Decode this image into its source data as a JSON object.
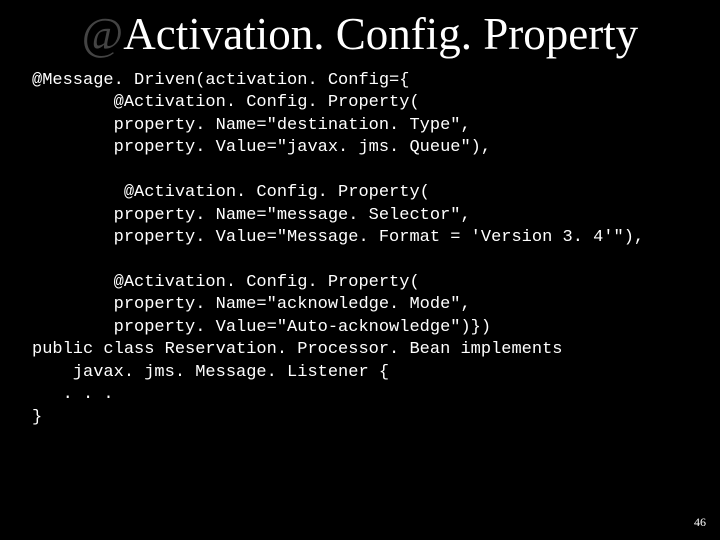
{
  "slide": {
    "title_at": "@",
    "title_rest": "Activation. Config. Property",
    "code_lines": [
      "@Message. Driven(activation. Config={",
      "        @Activation. Config. Property(",
      "        property. Name=\"destination. Type\",",
      "        property. Value=\"javax. jms. Queue\"),",
      "",
      "         @Activation. Config. Property(",
      "        property. Name=\"message. Selector\",",
      "        property. Value=\"Message. Format = 'Version 3. 4'\"),",
      "",
      "        @Activation. Config. Property(",
      "        property. Name=\"acknowledge. Mode\",",
      "        property. Value=\"Auto-acknowledge\")})",
      "public class Reservation. Processor. Bean implements",
      "    javax. jms. Message. Listener {",
      "   . . .",
      "}"
    ],
    "page_number": "46"
  }
}
